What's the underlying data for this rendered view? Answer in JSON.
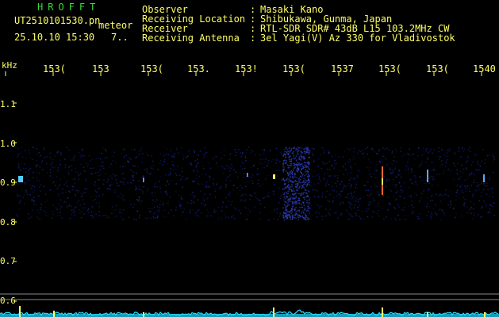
{
  "header": {
    "app_title": "HROFFT",
    "file_name": "UT2510101530.pn",
    "tag": "meteor",
    "date_time": "25.10.10 15:30",
    "count": "7..",
    "meta": [
      {
        "label": "Observer",
        "value": "Masaki Kano"
      },
      {
        "label": "Receiving Location",
        "value": "Shibukawa, Gunma, Japan"
      },
      {
        "label": "Receiver",
        "value": "RTL-SDR SDR# 43dB L15 103.2MHz CW"
      },
      {
        "label": "Receiving Antenna",
        "value": "3el Yagi(V) Az 330 for Vladivostok"
      }
    ],
    "colon": ":"
  },
  "axes": {
    "y_unit_label": "kHz",
    "top_tick_labels": [
      "153(",
      "153",
      "153(",
      "153.",
      "153!",
      "153(",
      "1537",
      "153(",
      "153(",
      "1540"
    ],
    "y_tick_labels": [
      "1.1",
      "1.0",
      "0.9",
      "0.8",
      "0.7",
      "0.6"
    ]
  },
  "colors": {
    "text": "#ffff66",
    "title": "#33dd33",
    "background": "#000000",
    "band_noise": "#1a2a9a",
    "signal": "#ffff66",
    "spectrum_trace": "#22ddff"
  }
}
